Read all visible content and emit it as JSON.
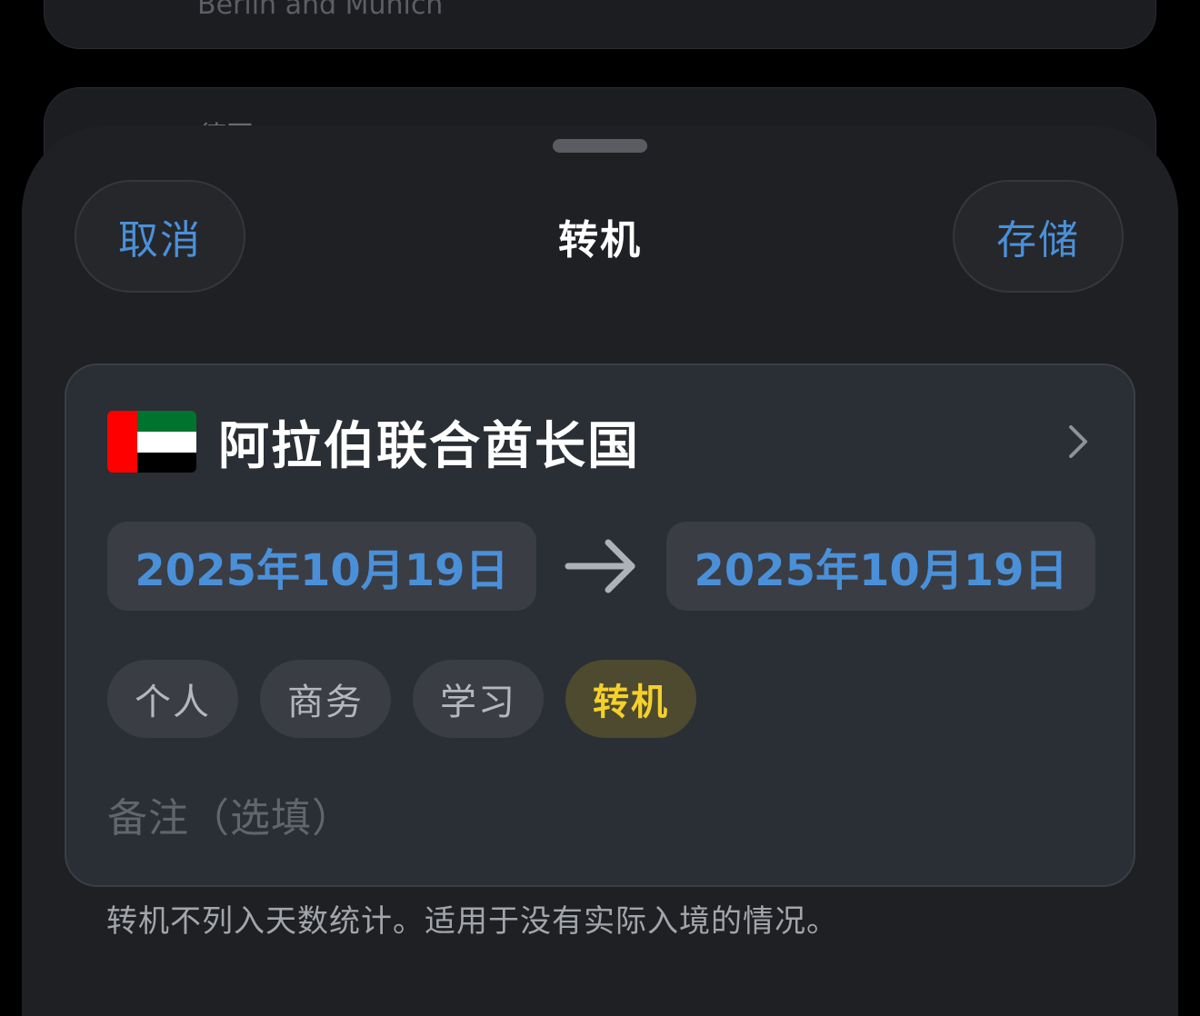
{
  "background": {
    "card1_text": "Berlin and Munich",
    "card2_text": "德国"
  },
  "sheet": {
    "title": "转机",
    "cancel_label": "取消",
    "save_label": "存储"
  },
  "entry": {
    "country": "阿拉伯联合酋长国",
    "flag_icon": "uae-flag-icon",
    "start_date": "2025年10月19日",
    "end_date": "2025年10月19日",
    "categories": [
      {
        "label": "个人",
        "selected": false
      },
      {
        "label": "商务",
        "selected": false
      },
      {
        "label": "学习",
        "selected": false
      },
      {
        "label": "转机",
        "selected": true
      }
    ],
    "notes_placeholder": "备注（选填）",
    "footnote": "转机不列入天数统计。适用于没有实际入境的情况。"
  },
  "colors": {
    "accent_blue": "#4a90d9",
    "selected_yellow": "#f5d02b"
  }
}
